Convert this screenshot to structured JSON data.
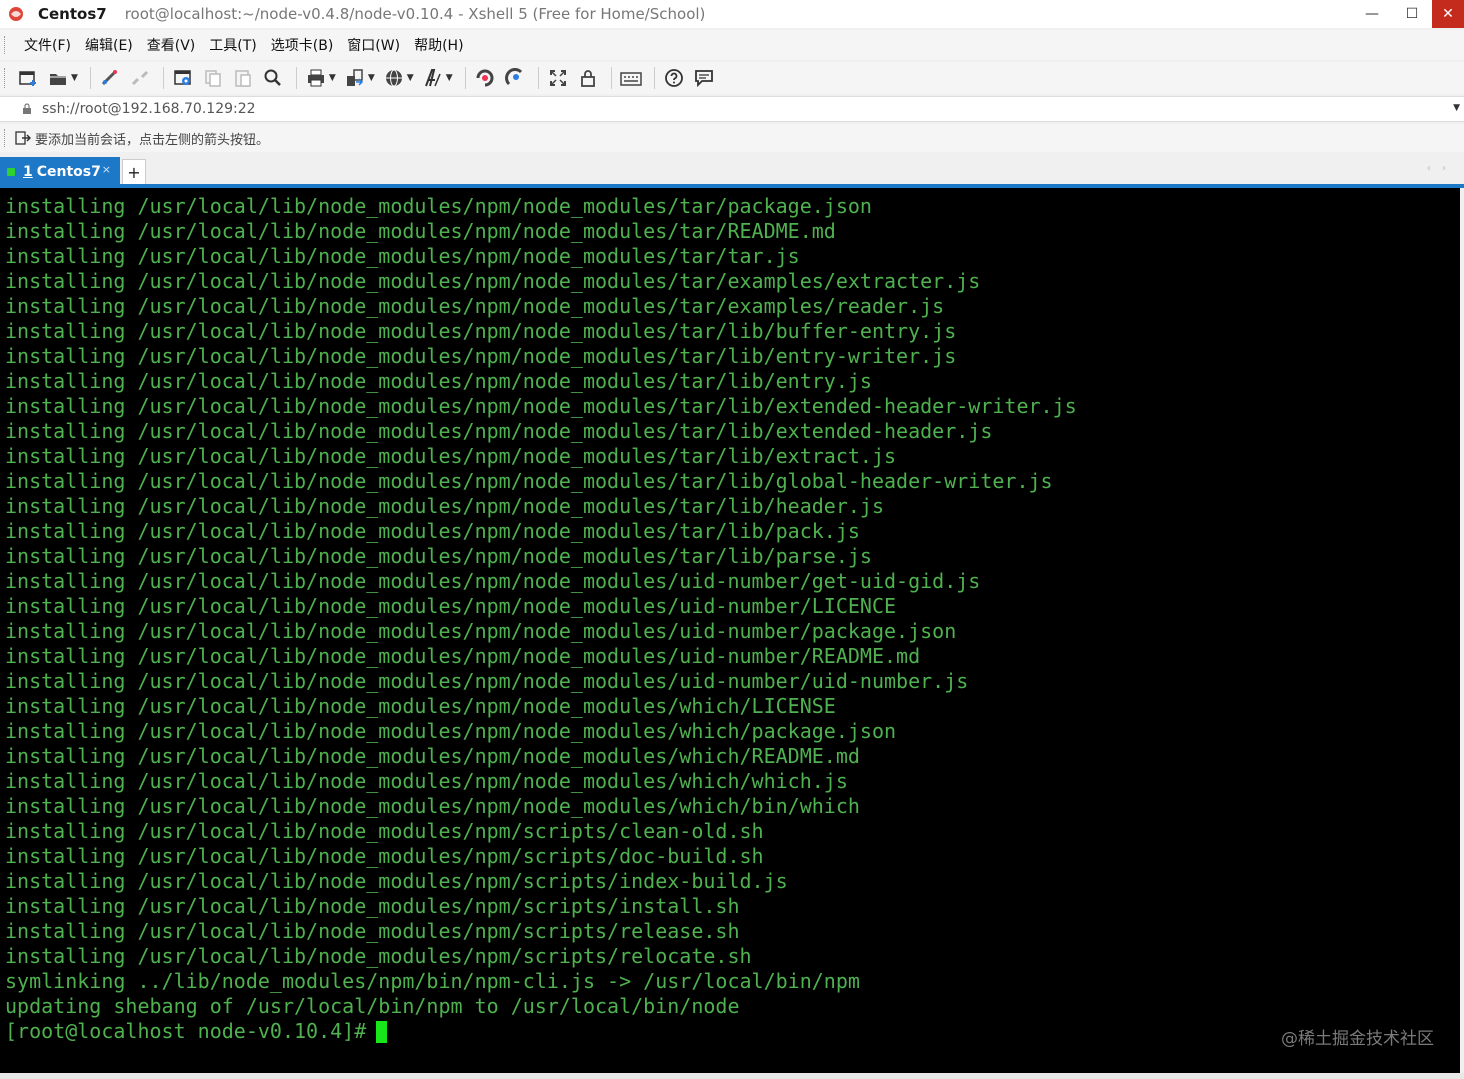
{
  "titlebar": {
    "session": "Centos7",
    "path": "root@localhost:~/node-v0.4.8/node-v0.10.4 - Xshell 5 (Free for Home/School)",
    "minimize": "—",
    "maximize": "☐",
    "close": "✕"
  },
  "menu": [
    "文件(F)",
    "编辑(E)",
    "查看(V)",
    "工具(T)",
    "选项卡(B)",
    "窗口(W)",
    "帮助(H)"
  ],
  "toolbar": {
    "icons": [
      "new-session-icon",
      "open-folder-icon",
      "reconnect-icon",
      "disconnect-icon",
      "properties-icon",
      "copy-icon",
      "paste-icon",
      "find-icon",
      "print-icon",
      "transfer-icon",
      "globe-icon",
      "font-icon",
      "xftp-icon",
      "xagent-icon",
      "fullscreen-icon",
      "lock-icon",
      "keyboard-icon",
      "help-icon",
      "chat-icon"
    ]
  },
  "address": {
    "value": "ssh://root@192.168.70.129:22"
  },
  "hint": {
    "text": "要添加当前会话，点击左侧的箭头按钮。"
  },
  "tab": {
    "number": "1",
    "label": "Centos7",
    "close": "×",
    "add": "+",
    "nav": "‹ ›"
  },
  "terminal": {
    "lines": [
      "installing /usr/local/lib/node_modules/npm/node_modules/tar/package.json",
      "installing /usr/local/lib/node_modules/npm/node_modules/tar/README.md",
      "installing /usr/local/lib/node_modules/npm/node_modules/tar/tar.js",
      "installing /usr/local/lib/node_modules/npm/node_modules/tar/examples/extracter.js",
      "installing /usr/local/lib/node_modules/npm/node_modules/tar/examples/reader.js",
      "installing /usr/local/lib/node_modules/npm/node_modules/tar/lib/buffer-entry.js",
      "installing /usr/local/lib/node_modules/npm/node_modules/tar/lib/entry-writer.js",
      "installing /usr/local/lib/node_modules/npm/node_modules/tar/lib/entry.js",
      "installing /usr/local/lib/node_modules/npm/node_modules/tar/lib/extended-header-writer.js",
      "installing /usr/local/lib/node_modules/npm/node_modules/tar/lib/extended-header.js",
      "installing /usr/local/lib/node_modules/npm/node_modules/tar/lib/extract.js",
      "installing /usr/local/lib/node_modules/npm/node_modules/tar/lib/global-header-writer.js",
      "installing /usr/local/lib/node_modules/npm/node_modules/tar/lib/header.js",
      "installing /usr/local/lib/node_modules/npm/node_modules/tar/lib/pack.js",
      "installing /usr/local/lib/node_modules/npm/node_modules/tar/lib/parse.js",
      "installing /usr/local/lib/node_modules/npm/node_modules/uid-number/get-uid-gid.js",
      "installing /usr/local/lib/node_modules/npm/node_modules/uid-number/LICENCE",
      "installing /usr/local/lib/node_modules/npm/node_modules/uid-number/package.json",
      "installing /usr/local/lib/node_modules/npm/node_modules/uid-number/README.md",
      "installing /usr/local/lib/node_modules/npm/node_modules/uid-number/uid-number.js",
      "installing /usr/local/lib/node_modules/npm/node_modules/which/LICENSE",
      "installing /usr/local/lib/node_modules/npm/node_modules/which/package.json",
      "installing /usr/local/lib/node_modules/npm/node_modules/which/README.md",
      "installing /usr/local/lib/node_modules/npm/node_modules/which/which.js",
      "installing /usr/local/lib/node_modules/npm/node_modules/which/bin/which",
      "installing /usr/local/lib/node_modules/npm/scripts/clean-old.sh",
      "installing /usr/local/lib/node_modules/npm/scripts/doc-build.sh",
      "installing /usr/local/lib/node_modules/npm/scripts/index-build.js",
      "installing /usr/local/lib/node_modules/npm/scripts/install.sh",
      "installing /usr/local/lib/node_modules/npm/scripts/release.sh",
      "installing /usr/local/lib/node_modules/npm/scripts/relocate.sh",
      "symlinking ../lib/node_modules/npm/bin/npm-cli.js -> /usr/local/bin/npm",
      "updating shebang of /usr/local/bin/npm to /usr/local/bin/node"
    ],
    "prompt": "[root@localhost node-v0.10.4]#",
    "text_color": "#4fb14f",
    "cursor_color": "#19e619"
  },
  "watermark": "@稀土掘金技术社区"
}
